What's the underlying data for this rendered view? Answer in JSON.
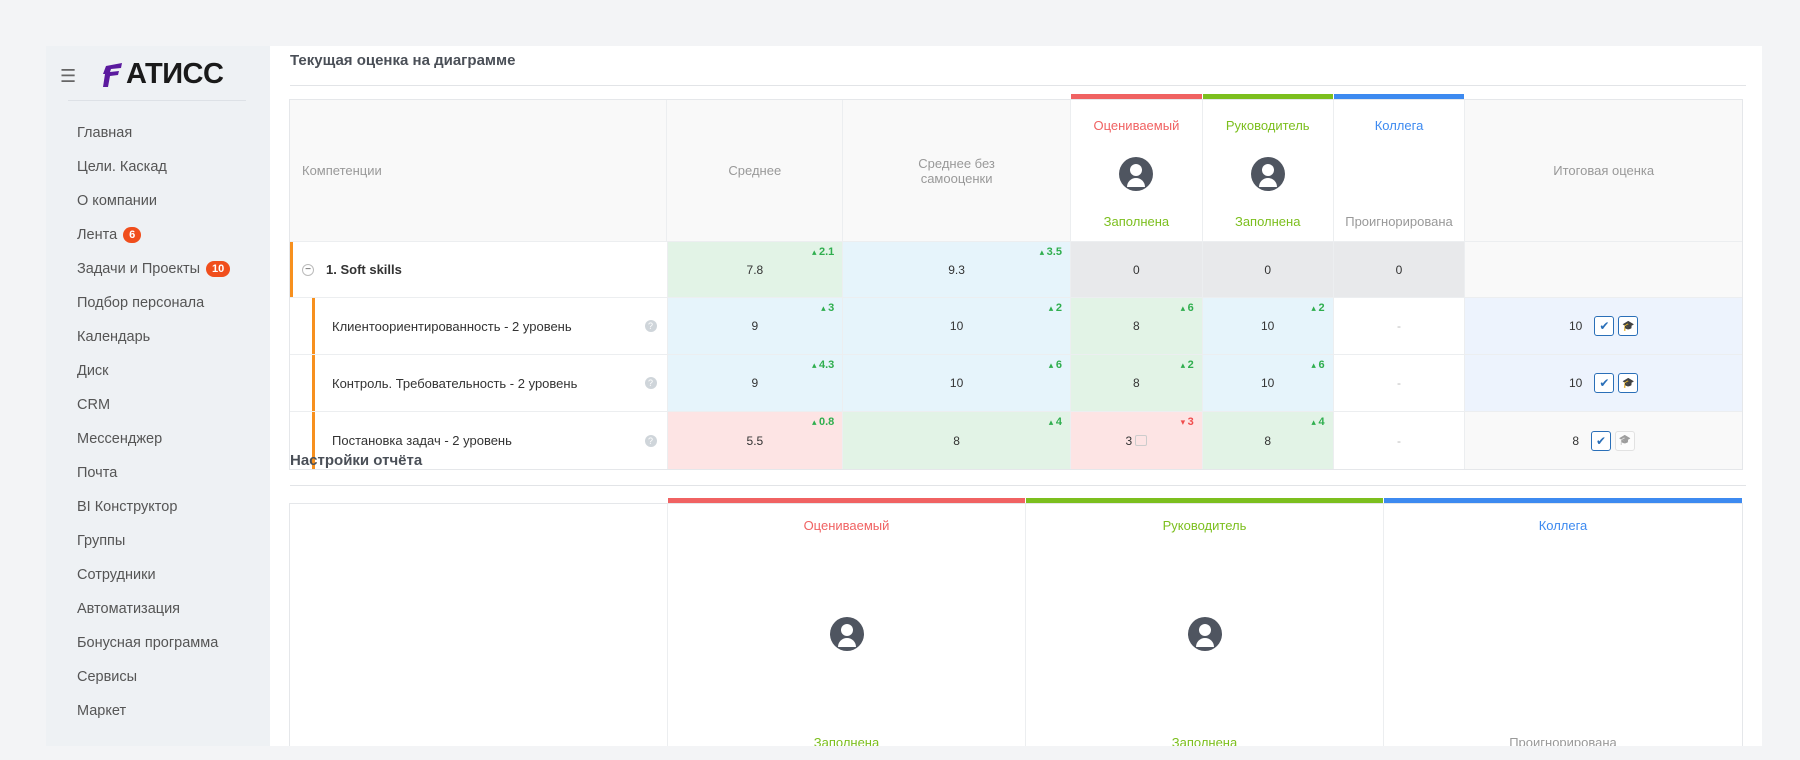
{
  "logo": "АТИСС",
  "nav": [
    {
      "label": "Главная"
    },
    {
      "label": "Цели. Каскад"
    },
    {
      "label": "О компании"
    },
    {
      "label": "Лента",
      "badge": "6"
    },
    {
      "label": "Задачи и Проекты",
      "badge": "10"
    },
    {
      "label": "Подбор персонала"
    },
    {
      "label": "Календарь"
    },
    {
      "label": "Диск"
    },
    {
      "label": "CRM"
    },
    {
      "label": "Мессенджер"
    },
    {
      "label": "Почта"
    },
    {
      "label": "BI Конструктор"
    },
    {
      "label": "Группы"
    },
    {
      "label": "Сотрудники"
    },
    {
      "label": "Автоматизация"
    },
    {
      "label": "Бонусная программа"
    },
    {
      "label": "Сервисы"
    },
    {
      "label": "Маркет"
    }
  ],
  "section1": {
    "title": "Текущая оценка на диаграмме",
    "headers": {
      "competencies": "Компетенции",
      "avg": "Среднее",
      "avg_noself": "Среднее без самооценки",
      "final": "Итоговая оценка"
    },
    "raters": [
      {
        "role": "Оцениваемый",
        "status": "Заполнена",
        "color": "#f06262",
        "status_color": "#7cbf1e",
        "avatar": true
      },
      {
        "role": "Руководитель",
        "status": "Заполнена",
        "color": "#7cbf1e",
        "status_color": "#7cbf1e",
        "avatar": true
      },
      {
        "role": "Коллега",
        "status": "Проигнорирована",
        "color": "#3d8af0",
        "status_color": "#999",
        "avatar": false
      }
    ],
    "group": {
      "name": "1. Soft skills",
      "cells": [
        {
          "v": "7.8",
          "d": "2.1",
          "dir": "up",
          "bg": "#e2f3e6"
        },
        {
          "v": "9.3",
          "d": "3.5",
          "dir": "up",
          "bg": "#e6f4fb"
        },
        {
          "v": "0",
          "bg": "#e8e9eb"
        },
        {
          "v": "0",
          "bg": "#e8e9eb"
        },
        {
          "v": "0",
          "bg": "#e8e9eb"
        }
      ]
    },
    "rows": [
      {
        "name": "Клиентоориентированность - 2 уровень",
        "cells": [
          {
            "v": "9",
            "d": "3",
            "dir": "up",
            "bg": "#e6f4fb"
          },
          {
            "v": "10",
            "d": "2",
            "dir": "up",
            "bg": "#e6f4fb"
          },
          {
            "v": "8",
            "d": "6",
            "dir": "up",
            "bg": "#e2f3e6"
          },
          {
            "v": "10",
            "d": "2",
            "dir": "up",
            "bg": "#e6f4fb"
          },
          {
            "v": "-",
            "bg": "#fff"
          }
        ],
        "final": "10",
        "final_bg": "#edf3fd",
        "edu_active": true
      },
      {
        "name": "Контроль. Требовательность - 2 уровень",
        "cells": [
          {
            "v": "9",
            "d": "4.3",
            "dir": "up",
            "bg": "#e6f4fb"
          },
          {
            "v": "10",
            "d": "6",
            "dir": "up",
            "bg": "#e6f4fb"
          },
          {
            "v": "8",
            "d": "2",
            "dir": "up",
            "bg": "#e2f3e6"
          },
          {
            "v": "10",
            "d": "6",
            "dir": "up",
            "bg": "#e6f4fb"
          },
          {
            "v": "-",
            "bg": "#fff"
          }
        ],
        "final": "10",
        "final_bg": "#edf3fd",
        "edu_active": true
      },
      {
        "name": "Постановка задач - 2 уровень",
        "cells": [
          {
            "v": "5.5",
            "d": "0.8",
            "dir": "up",
            "bg": "#fde4e4"
          },
          {
            "v": "8",
            "d": "4",
            "dir": "up",
            "bg": "#e2f3e6"
          },
          {
            "v": "3",
            "d": "3",
            "dir": "down",
            "bg": "#fde4e4",
            "comment": true
          },
          {
            "v": "8",
            "d": "4",
            "dir": "up",
            "bg": "#e2f3e6"
          },
          {
            "v": "-",
            "bg": "#fff"
          }
        ],
        "final": "8",
        "final_bg": "#f9f9f9",
        "edu_active": false
      }
    ]
  },
  "section2": {
    "title": "Настройки отчёта"
  }
}
